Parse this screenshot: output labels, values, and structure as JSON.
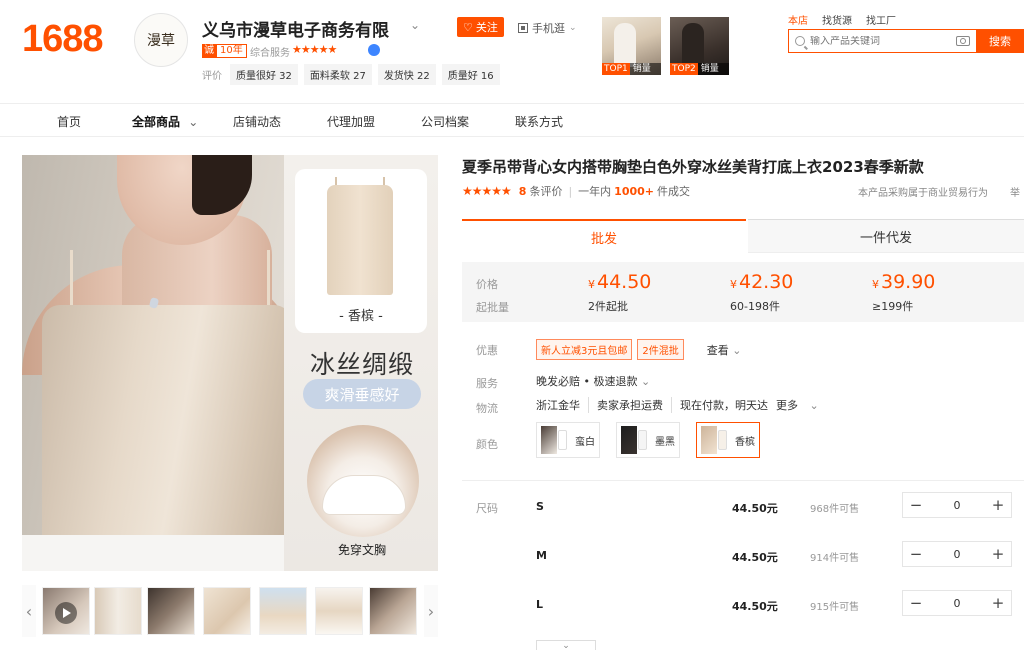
{
  "header": {
    "logo": "1688",
    "shop_logo_text": "漫草",
    "shop_name": "义乌市漫草电子商务有限",
    "follow_label": "关注",
    "mobile_label": "手机逛",
    "years_icon": "诚",
    "years_value": "10年",
    "service_label": "综合服务",
    "service_stars": "★★★★★",
    "eval_label": "评价",
    "eval_tags": [
      {
        "text": "质量很好 32"
      },
      {
        "text": "面料柔软 27"
      },
      {
        "text": "发货快 22"
      },
      {
        "text": "质量好 16"
      }
    ],
    "top_cards": [
      {
        "rank": "TOP1",
        "text": "销量"
      },
      {
        "rank": "TOP2",
        "text": "销量"
      }
    ],
    "search_tabs": [
      "本店",
      "找货源",
      "找工厂"
    ],
    "search_placeholder": "输入产品关键词",
    "search_button": "搜索"
  },
  "nav": {
    "items": [
      "首页",
      "全部商品",
      "店铺动态",
      "代理加盟",
      "公司档案",
      "联系方式"
    ],
    "active": "全部商品"
  },
  "gallery": {
    "card_label": "- 香槟 -",
    "panel_title": "冰丝绸缎",
    "panel_pill": "爽滑垂感好",
    "circle_label": "免穿文胸"
  },
  "product": {
    "title": "夏季吊带背心女内搭带胸垫白色外穿冰丝美背打底上衣2023春季新款",
    "rating_stars": "★★★★★",
    "review_count": "8",
    "review_label": "条评价",
    "year_label": "一年内",
    "sold_count": "1000+",
    "sold_label": "件成交",
    "trade_note": "本产品采购属于商业贸易行为",
    "trade_note2": "举"
  },
  "tabs": {
    "batch": "批发",
    "single": "一件代发"
  },
  "pricing": {
    "price_label": "价格",
    "moq_label": "起批量",
    "currency": "¥",
    "tiers": [
      {
        "price": "44.50",
        "qty": "2件起批"
      },
      {
        "price": "42.30",
        "qty": "60-198件"
      },
      {
        "price": "39.90",
        "qty": "≥199件"
      }
    ]
  },
  "details": {
    "promo_label": "优惠",
    "promo_tags": [
      "新人立减3元且包邮",
      "2件混批"
    ],
    "promo_view": "查看",
    "service_label": "服务",
    "service_value": "晚发必赔 • 极速退款",
    "logistics_label": "物流",
    "logistics": [
      "浙江金华",
      "卖家承担运费",
      "现在付款，明天达",
      "更多"
    ],
    "color_label": "颜色",
    "colors": [
      {
        "name": "蛮白",
        "swatch_a": "#efe9e2",
        "swatch_b": "#ffffff"
      },
      {
        "name": "墨黑",
        "swatch_a": "#3a3330",
        "swatch_b": "#1d1d1d"
      },
      {
        "name": "香槟",
        "swatch_a": "#e2cdb6",
        "swatch_b": "#f1e3d2"
      }
    ],
    "selected_color": "香槟",
    "size_label": "尺码",
    "sizes": [
      {
        "name": "S",
        "price": "44.50元",
        "stock": "968件可售",
        "qty": "0"
      },
      {
        "name": "M",
        "price": "44.50元",
        "stock": "914件可售",
        "qty": "0"
      },
      {
        "name": "L",
        "price": "44.50元",
        "stock": "915件可售",
        "qty": "0"
      }
    ]
  },
  "colors": {
    "accent": "#ff5000",
    "pill": "#c7d4e6"
  }
}
